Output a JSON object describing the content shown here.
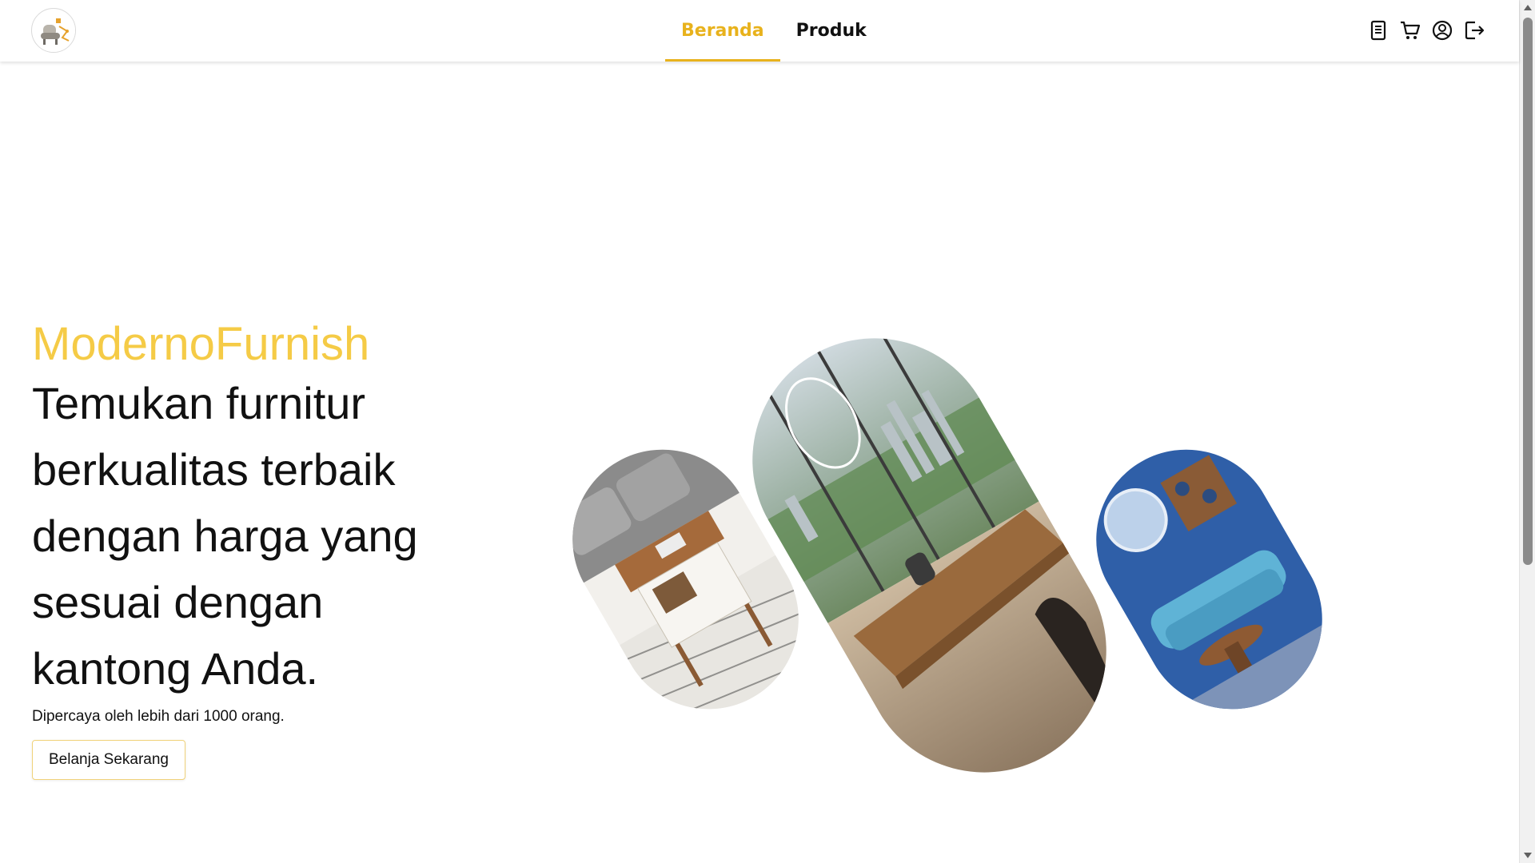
{
  "header": {
    "logo_icon": "furniture-chair-logo-icon",
    "tabs": [
      {
        "label": "Beranda",
        "active": true
      },
      {
        "label": "Produk",
        "active": false
      }
    ],
    "accent_color": "#e8b21c",
    "icons": [
      "orders-document-icon",
      "cart-icon",
      "user-account-icon",
      "logout-icon"
    ]
  },
  "hero": {
    "brand": "ModernoFurnish",
    "brand_color": "#f5cb46",
    "headline": "Temukan furnitur\nberkualitas terbaik\ndengan harga yang\nsesuai dengan\nkantong Anda.",
    "subline": "Dipercaya oleh lebih dari 1000 orang.",
    "cta_label": "Belanja Sekarang"
  },
  "images": [
    {
      "name": "lift-top-coffee-table-photo"
    },
    {
      "name": "dining-room-city-view-photo"
    },
    {
      "name": "blue-living-room-sofa-photo"
    }
  ]
}
